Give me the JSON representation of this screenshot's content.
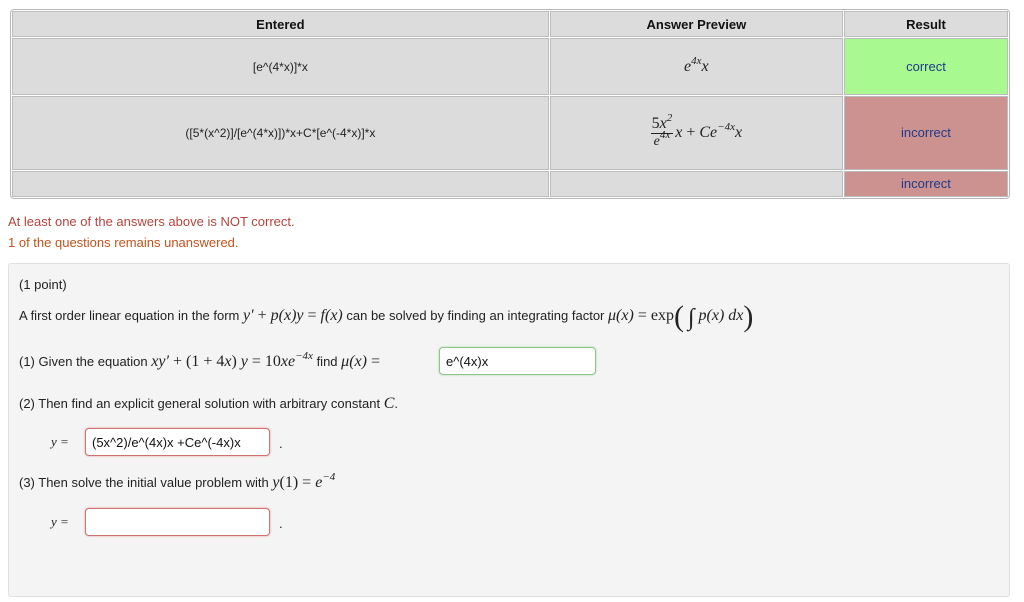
{
  "results_table": {
    "headers": [
      "Entered",
      "Answer Preview",
      "Result"
    ],
    "rows": [
      {
        "entered": "[e^(4*x)]*x",
        "preview": "e^{4x} x",
        "result": "correct"
      },
      {
        "entered": "([5*(x^2)]/[e^(4*x)])*x+C*[e^(-4*x)]*x",
        "preview": "5x^2/e^{4x} x + Ce^{-4x} x",
        "result": "incorrect"
      },
      {
        "entered": "",
        "preview": "",
        "result": "incorrect"
      }
    ],
    "colors": {
      "correct": "#a8f990",
      "incorrect": "#cc9290"
    }
  },
  "messages": {
    "not_correct": "At least one of the answers above is NOT correct.",
    "unanswered": "1 of the questions remains unanswered."
  },
  "problem": {
    "points": "(1 point)",
    "intro_prefix": "A first order linear equation in the form",
    "intro_middle": "can be solved by finding an integrating factor",
    "part1_prefix": "(1) Given the equation",
    "part1_find": "find",
    "part1_value": "e^(4x)x",
    "part2_text": "(2) Then find an explicit general solution with arbitrary constant",
    "part2_value": "(5x^2)/e^(4x)x +Ce^(-4x)x",
    "part3_text": "(3) Then solve the initial value problem with",
    "part3_value": "",
    "y_eq": "y ="
  }
}
